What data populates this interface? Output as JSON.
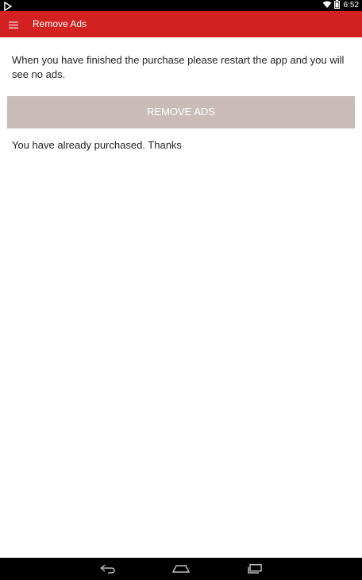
{
  "status_bar": {
    "time": "6:52",
    "icons": [
      "play-store-notification-icon",
      "wifi-icon",
      "battery-icon"
    ]
  },
  "app_bar": {
    "title": "Remove Ads",
    "menu_icon": "hamburger-menu-icon",
    "color": "#d32020"
  },
  "main": {
    "info_text": "When you have finished the purchase please restart the app and you will see no ads.",
    "remove_ads_label": "REMOVE ADS",
    "button_color": "#c9bcb6",
    "purchased_text": "You have already purchased. Thanks"
  },
  "nav_bar": {
    "buttons": [
      "back-icon",
      "home-icon",
      "recents-icon"
    ]
  }
}
